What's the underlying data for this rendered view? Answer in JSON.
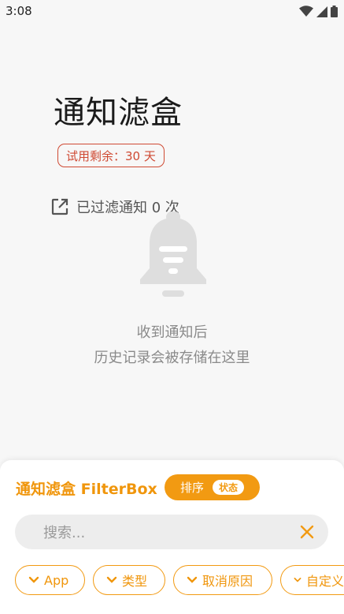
{
  "status_bar": {
    "time": "3:08",
    "icons": [
      "wifi-icon",
      "cell-signal-icon",
      "battery-icon"
    ]
  },
  "header": {
    "title": "通知滤盒",
    "trial_text": "试用剩余：30 天",
    "filtered_text": "已过滤通知 0 次"
  },
  "empty_state": {
    "icon": "bell-icon",
    "line1": "收到通知后",
    "line2": "历史记录会被存储在这里"
  },
  "bottom_sheet": {
    "brand": "通知滤盒 FilterBox",
    "sort_label": "排序",
    "sort_value": "状态",
    "search_placeholder": "搜索...",
    "filter_chips": [
      {
        "label": "App"
      },
      {
        "label": "类型"
      },
      {
        "label": "取消原因"
      },
      {
        "label": "自定义"
      }
    ]
  },
  "colors": {
    "accent": "#f29a12",
    "trial_red": "#cf4a33",
    "background": "#f7f7f7"
  }
}
